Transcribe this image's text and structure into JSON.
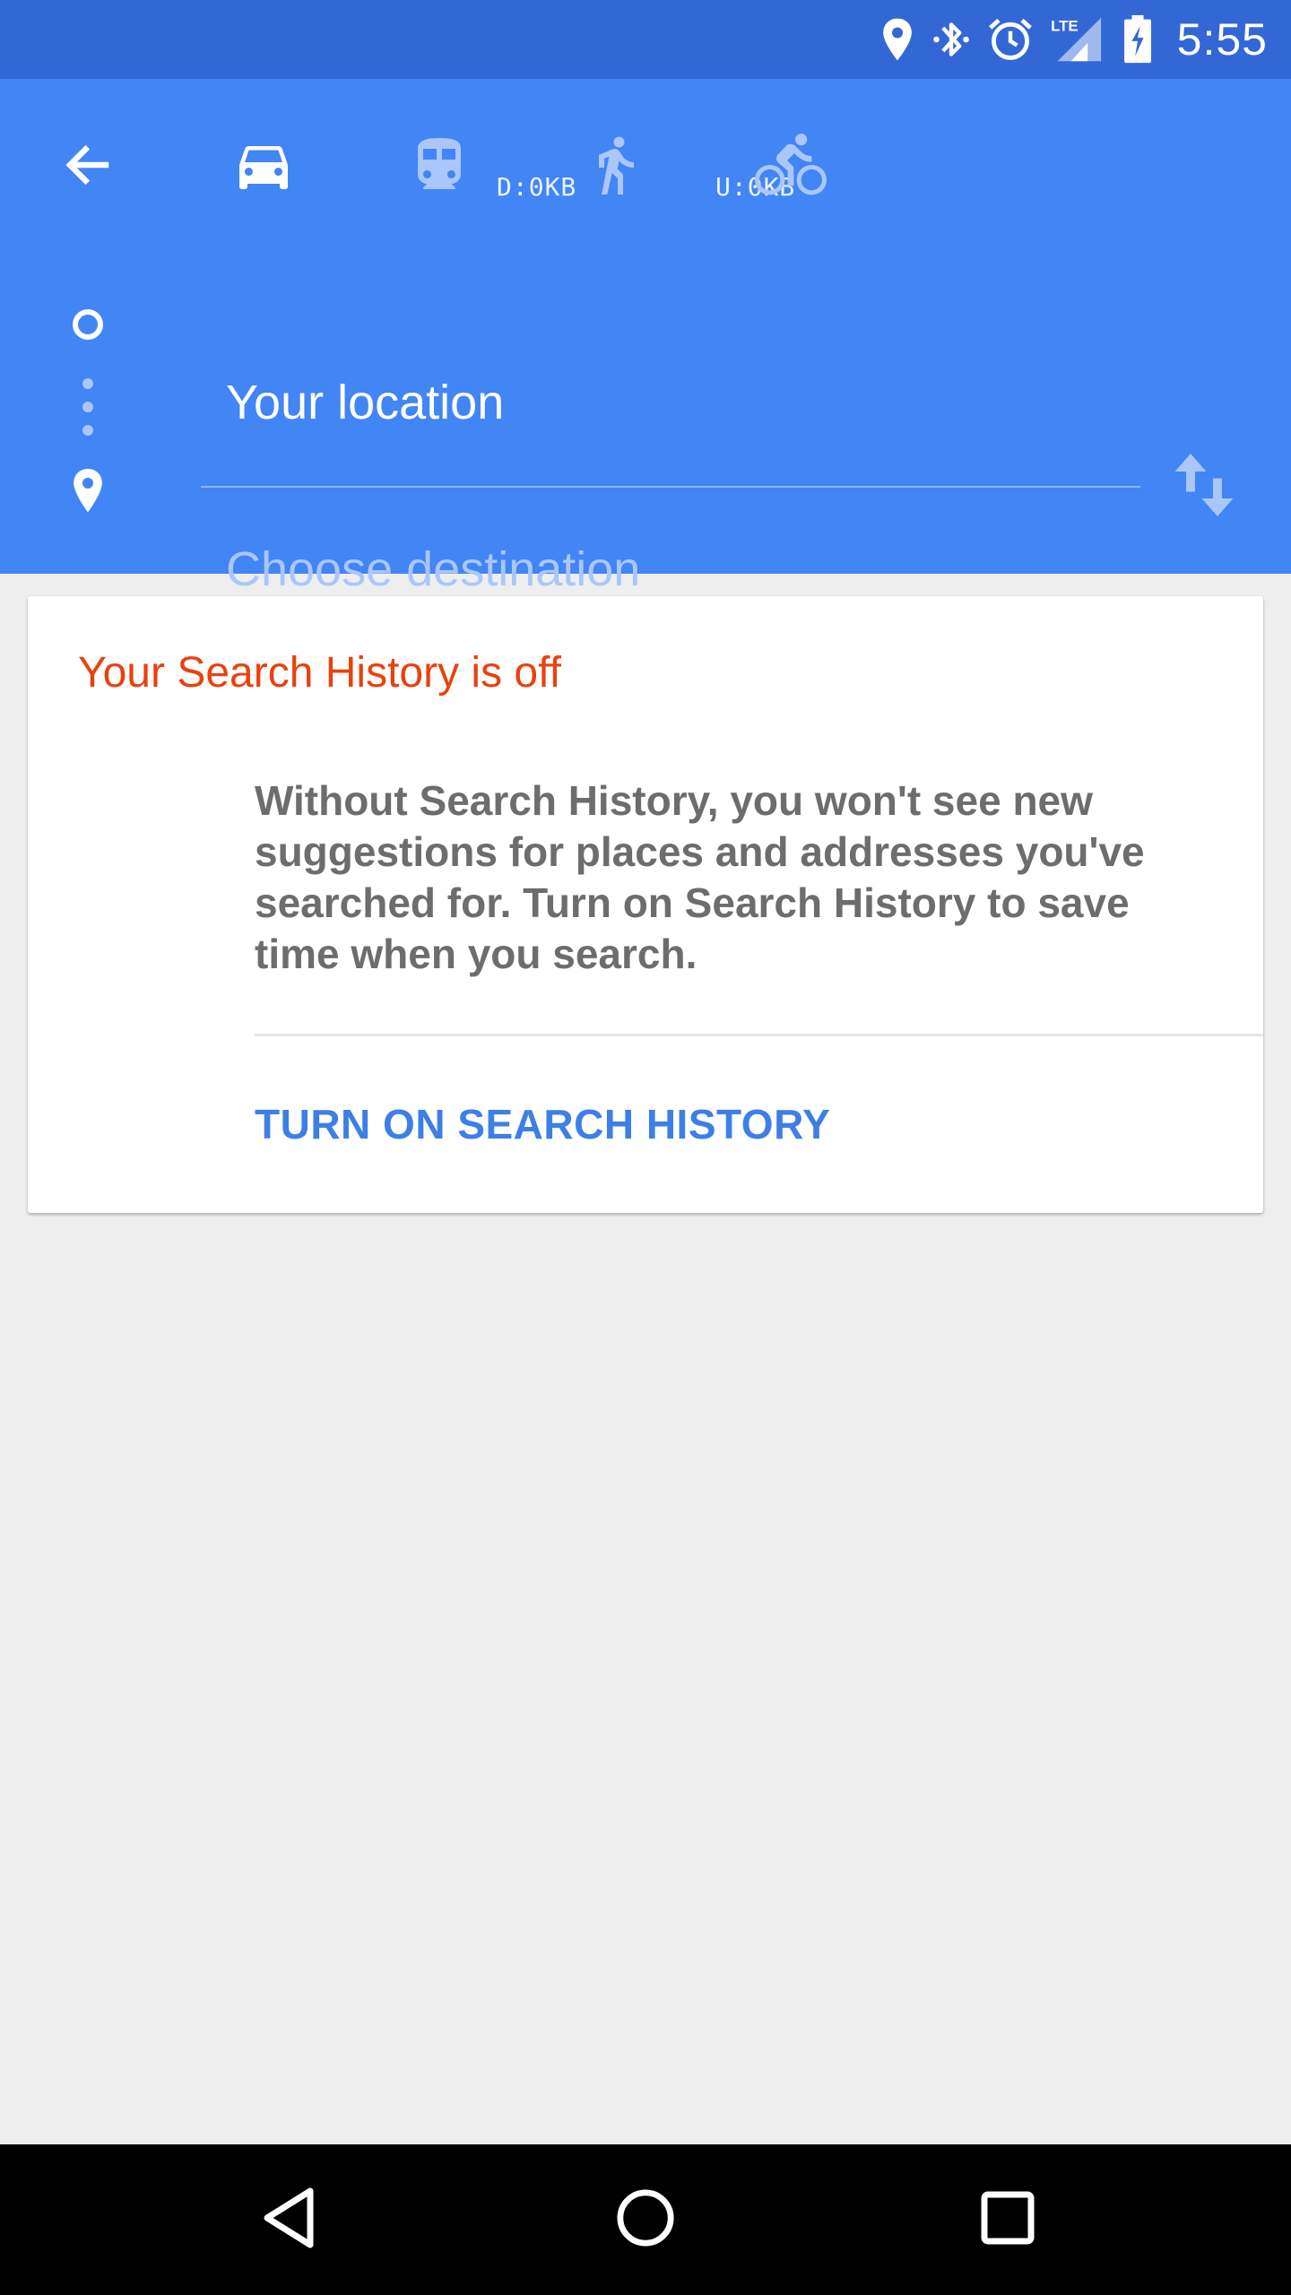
{
  "status_bar": {
    "time": "5:55",
    "icons": [
      "location-icon",
      "bluetooth-icon",
      "alarm-icon",
      "lte-signal-icon",
      "battery-charging-icon"
    ],
    "network_label": "LTE"
  },
  "overlay": {
    "download": "D:0KB",
    "upload": "U:0KB"
  },
  "toolbar": {
    "back_icon": "back-arrow-icon",
    "modes": [
      {
        "name": "driving",
        "icon": "car-icon",
        "selected": true
      },
      {
        "name": "transit",
        "icon": "train-icon",
        "selected": false
      },
      {
        "name": "walking",
        "icon": "walk-icon",
        "selected": false
      },
      {
        "name": "cycling",
        "icon": "bike-icon",
        "selected": false
      }
    ]
  },
  "route": {
    "origin_value": "Your location",
    "destination_placeholder": "Choose destination",
    "swap_icon": "swap-icon"
  },
  "card": {
    "title": "Your Search History is off",
    "body": "Without Search History, you won't see new suggestions for places and addresses you've searched for. Turn on Search History to save time when you search.",
    "action_label": "TURN ON SEARCH HISTORY"
  },
  "colors": {
    "status_bar": "#3367d6",
    "app_bar": "#4285f4",
    "card_title": "#e8420e",
    "action": "#3d7fe6",
    "background": "#eeeeee"
  }
}
